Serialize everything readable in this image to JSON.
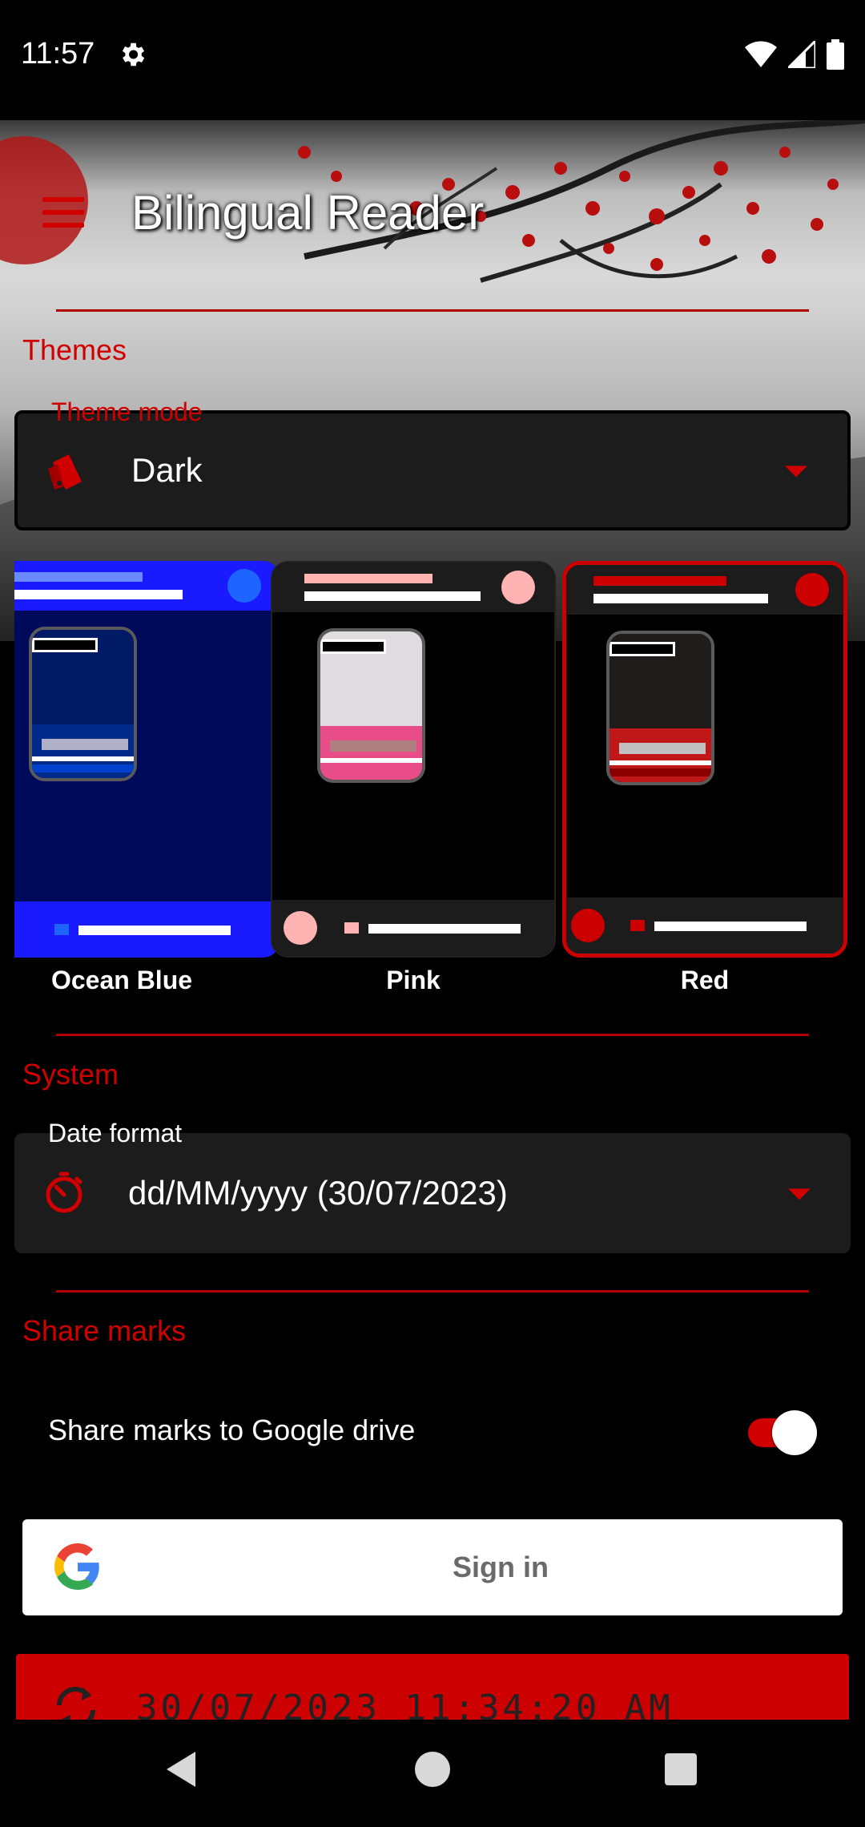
{
  "status": {
    "time": "11:57"
  },
  "appbar": {
    "title": "Bilingual Reader"
  },
  "themes": {
    "section_title": "Themes",
    "mode_label": "Theme mode",
    "mode_value": "Dark",
    "cards": [
      {
        "label": "Ocean Blue",
        "accent": "#1a1aff",
        "selected": false
      },
      {
        "label": "Pink",
        "accent": "#ffb3b3",
        "selected": false
      },
      {
        "label": "Red",
        "accent": "#cc0000",
        "selected": true
      }
    ]
  },
  "system": {
    "section_title": "System",
    "date_label": "Date format",
    "date_value": "dd/MM/yyyy (30/07/2023)"
  },
  "share": {
    "section_title": "Share marks",
    "toggle_label": "Share marks to Google drive",
    "toggle_on": true,
    "signin_label": "Sign in",
    "last_sync": "30/07/2023 11:34:20 AM"
  },
  "colors": {
    "accent": "#d10000",
    "background": "#000000",
    "surface": "#1c1c1c"
  }
}
